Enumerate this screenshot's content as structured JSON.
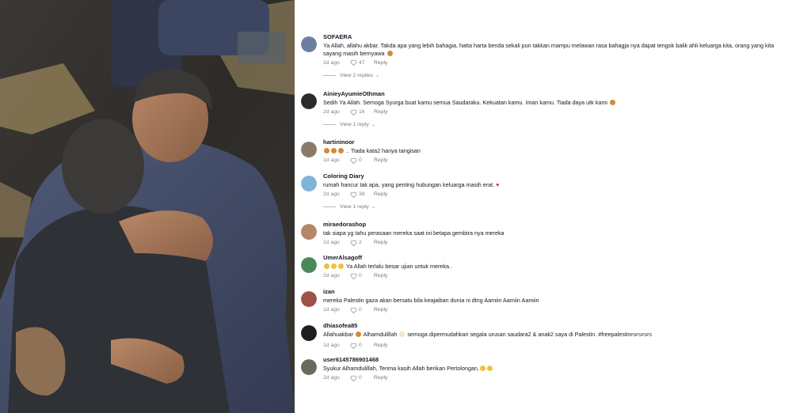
{
  "comments": [
    {
      "username": "SOFAERA",
      "text": "Ya Allah, allahu akbar. Takda apa yang lebih bahagia, hatta harta benda sekali pun takkan mampu melawan rasa bahagja nya dapat tengok balik ahli keluarga kita, orang yang kita sayang masih bernyawa",
      "date": "2d ago",
      "likes": "47",
      "reply": "Reply",
      "avatar_color": "#6b7fa0",
      "view_replies": "View 2 replies"
    },
    {
      "username": "AinieyAyumieOthman",
      "text": "Sedih Ya Allah. Semoga Syurga buat kamu semua Saudaraku. Kekuatan kamu. Iman kamu. Tiada daya utk kami",
      "date": "2d ago",
      "likes": "16",
      "reply": "Reply",
      "avatar_color": "#2b2b2b",
      "view_replies": "View 1 reply"
    },
    {
      "username": "hartininoor",
      "text": ".. Tiada kata2 hanya tangisan",
      "date": "1d ago",
      "likes": "0",
      "reply": "Reply",
      "avatar_color": "#8a7a6a"
    },
    {
      "username": "Coloring Diary",
      "text": "rumah hancur tak apa, yang penting hubungan keluarga masih erat.",
      "date": "2d ago",
      "likes": "38",
      "reply": "Reply",
      "avatar_color": "#7fb5d8",
      "view_replies": "View 1 reply"
    },
    {
      "username": "miraedorashop",
      "text": "tak siapa yg tahu perasaan mereka saat ini betapa gembira nya mereka",
      "date": "1d ago",
      "likes": "2",
      "reply": "Reply",
      "avatar_color": "#b5866a"
    },
    {
      "username": "UmerAlsagoff",
      "text": "Ya Allah terlalu besar ujian untuk mereka..",
      "date": "2d ago",
      "likes": "0",
      "reply": "Reply",
      "avatar_color": "#4a8a5a"
    },
    {
      "username": "izan",
      "text": "mereka Palestin gaza akan bersatu bila keajaiban dunia ni dtng Aamiin Aamiin Aamiin",
      "date": "1d ago",
      "likes": "0",
      "reply": "Reply",
      "avatar_color": "#a0524a"
    },
    {
      "username": "dhiasofea85",
      "text_a": "Allahuakbar",
      "text_b": "Alhamdulillah",
      "text_c": "semoga dipermudahkan segala urusan saudara2 & anak2 saya di Palestin. #freepalestin",
      "text_small": "PSPSPSPS",
      "date": "1d ago",
      "likes": "0",
      "reply": "Reply",
      "avatar_color": "#1e1e1e"
    },
    {
      "username": "user6145786901468",
      "text": "Syukur Alhamdulillah, Terima kasih Allah berikan Pertolongan,",
      "date": "2d ago",
      "likes": "0",
      "reply": "Reply",
      "avatar_color": "#6a6a5a"
    }
  ],
  "colors": {
    "text": "#161823",
    "muted": "#8a8b91",
    "heart_emoji": "#e0245e",
    "sad_emoji": "#d08a3a",
    "pray_emoji": "#f0c040"
  },
  "icons": {
    "like": "heart-outline-icon",
    "chevron": "chevron-down-icon"
  }
}
